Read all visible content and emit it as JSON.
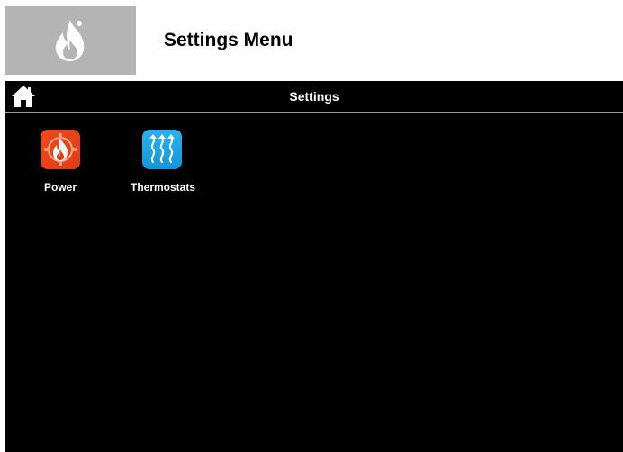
{
  "document": {
    "title": "Settings Menu",
    "logo_icon": "flame-icon",
    "logo_bg": "#b4b4b4"
  },
  "screen": {
    "title": "Settings",
    "home_icon": "home-icon",
    "background": "#000000",
    "tiles": [
      {
        "label": "Power",
        "icon": "power-flame-icon",
        "color": "#e84218"
      },
      {
        "label": "Thermostats",
        "icon": "thermostat-heat-waves-icon",
        "color": "#1ea4e4"
      }
    ]
  }
}
